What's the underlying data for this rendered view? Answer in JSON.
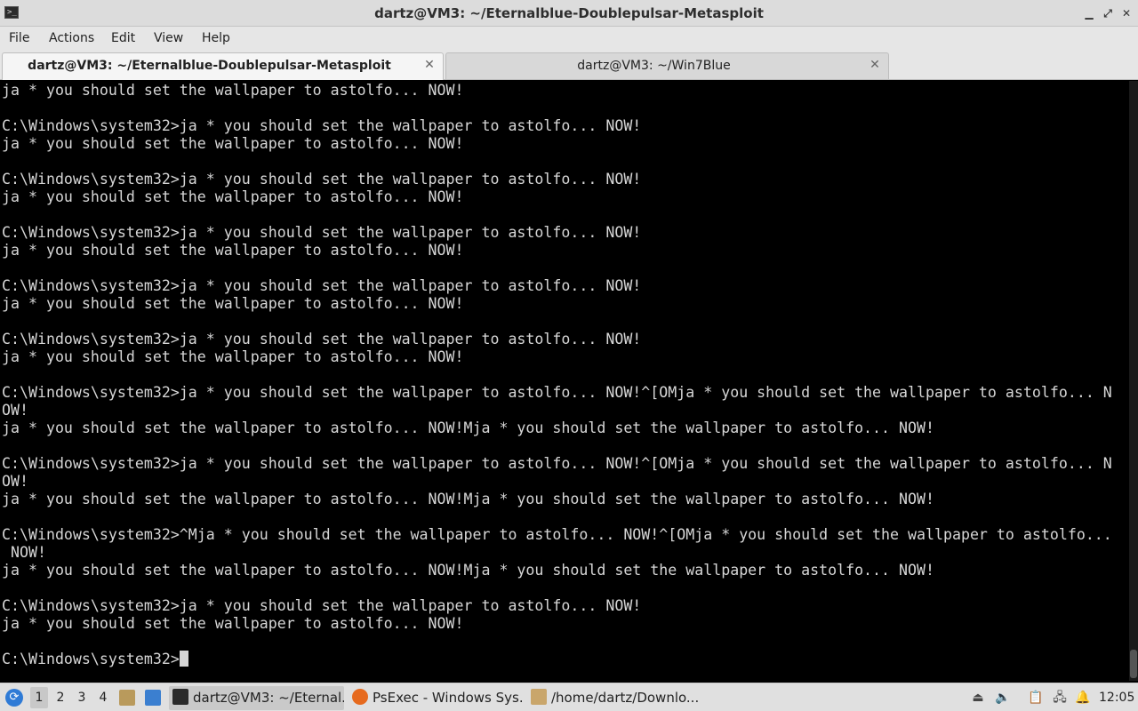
{
  "window": {
    "title": "dartz@VM3: ~/Eternalblue-Doublepulsar-Metasploit",
    "minimize_glyph": "▁",
    "maximize_glyph": "⤢",
    "close_glyph": "✕"
  },
  "menu": [
    "File",
    "Actions",
    "Edit",
    "View",
    "Help"
  ],
  "tabs": [
    {
      "label": "dartz@VM3: ~/Eternalblue-Doublepulsar-Metasploit",
      "active": true
    },
    {
      "label": "dartz@VM3: ~/Win7Blue",
      "active": false
    }
  ],
  "terminal": {
    "lines": [
      "ja * you should set the wallpaper to astolfo... NOW!",
      "",
      "C:\\Windows\\system32>ja * you should set the wallpaper to astolfo... NOW!",
      "ja * you should set the wallpaper to astolfo... NOW!",
      "",
      "C:\\Windows\\system32>ja * you should set the wallpaper to astolfo... NOW!",
      "ja * you should set the wallpaper to astolfo... NOW!",
      "",
      "C:\\Windows\\system32>ja * you should set the wallpaper to astolfo... NOW!",
      "ja * you should set the wallpaper to astolfo... NOW!",
      "",
      "C:\\Windows\\system32>ja * you should set the wallpaper to astolfo... NOW!",
      "ja * you should set the wallpaper to astolfo... NOW!",
      "",
      "C:\\Windows\\system32>ja * you should set the wallpaper to astolfo... NOW!",
      "ja * you should set the wallpaper to astolfo... NOW!",
      "",
      "C:\\Windows\\system32>ja * you should set the wallpaper to astolfo... NOW!^[OMja * you should set the wallpaper to astolfo... N",
      "OW!",
      "ja * you should set the wallpaper to astolfo... NOW!Mja * you should set the wallpaper to astolfo... NOW!",
      "",
      "C:\\Windows\\system32>ja * you should set the wallpaper to astolfo... NOW!^[OMja * you should set the wallpaper to astolfo... N",
      "OW!",
      "ja * you should set the wallpaper to astolfo... NOW!Mja * you should set the wallpaper to astolfo... NOW!",
      "",
      "C:\\Windows\\system32>^Mja * you should set the wallpaper to astolfo... NOW!^[OMja * you should set the wallpaper to astolfo...",
      " NOW!",
      "ja * you should set the wallpaper to astolfo... NOW!Mja * you should set the wallpaper to astolfo... NOW!",
      "",
      "C:\\Windows\\system32>ja * you should set the wallpaper to astolfo... NOW!",
      "ja * you should set the wallpaper to astolfo... NOW!",
      ""
    ],
    "prompt": "C:\\Windows\\system32>"
  },
  "taskbar": {
    "workspaces": [
      "1",
      "2",
      "3",
      "4"
    ],
    "active_workspace": "1",
    "tasks": [
      {
        "label": "dartz@VM3: ~/Eternal...",
        "icon": "terminal-icon",
        "active": true
      },
      {
        "label": "PsExec - Windows Sys...",
        "icon": "firefox-icon",
        "active": false
      },
      {
        "label": "/home/dartz/Downlo...",
        "icon": "archive-icon",
        "active": false
      }
    ],
    "clock": "12:05"
  },
  "colors": {
    "terminal_bg": "#000000",
    "terminal_fg": "#d6d6d6",
    "accent": "#2f7bd6"
  }
}
